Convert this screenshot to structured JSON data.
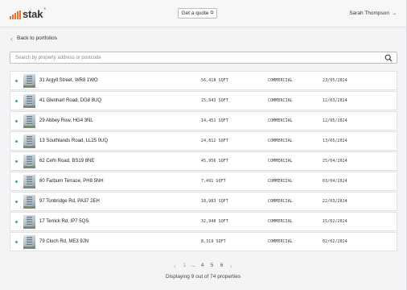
{
  "header": {
    "logo_text": "stak",
    "logo_mark": "®",
    "brand_color": "#e8742f",
    "quote_button": "Get a quote",
    "quote_icon": "external-link-icon",
    "user_name": "Sarah Thompson",
    "user_menu_icon": "chevron-down-icon"
  },
  "back_link": "Back to portfolios",
  "search": {
    "placeholder": "Search by property address or postcode",
    "icon": "search-icon"
  },
  "properties": [
    {
      "address": "31 Argyll Street, WR8 1WO",
      "sqft": "56,418 SQFT",
      "type": "COMMERCIAL",
      "date": "23/05/2024"
    },
    {
      "address": "41 Glenhart Road, DG8 8UQ",
      "sqft": "15,943 SQFT",
      "type": "COMMERCIAL",
      "date": "12/03/2024"
    },
    {
      "address": "29 Abbey Row, HG4 3NL",
      "sqft": "14,451 SQFT",
      "type": "COMMERCIAL",
      "date": "12/05/2024"
    },
    {
      "address": "13 Southlands Road, LL25 0UQ",
      "sqft": "24,812 SQFT",
      "type": "COMMERCIAL",
      "date": "13/05/2024"
    },
    {
      "address": "62 Cefn Road, BS19 8NE",
      "sqft": "45,956 SQFT",
      "type": "COMMERCIAL",
      "date": "25/04/2024"
    },
    {
      "address": "60 Farburn Terrace, PH8 5NH",
      "sqft": "7,491 SQFT",
      "type": "COMMERCIAL",
      "date": "03/04/2024"
    },
    {
      "address": "97 Tonbridge Rd, PA37 2EH",
      "sqft": "18,983 SQFT",
      "type": "COMMERCIAL",
      "date": "22/03/2024"
    },
    {
      "address": "17 Terrick Rd, IP7 5QS",
      "sqft": "32,940 SQFT",
      "type": "COMMERCIAL",
      "date": "15/02/2024"
    },
    {
      "address": "79 Cloch Rd, ME3 9JN",
      "sqft": "8,319 SQFT",
      "type": "COMMERCIAL",
      "date": "02/02/2024"
    }
  ],
  "status_color": "#2fb37a",
  "pagination": {
    "prev": "‹",
    "current": "1",
    "ellipsis": "...",
    "pages": [
      "4",
      "5",
      "6"
    ],
    "next": "›"
  },
  "summary": "Displaying 9 out of 74 properties"
}
